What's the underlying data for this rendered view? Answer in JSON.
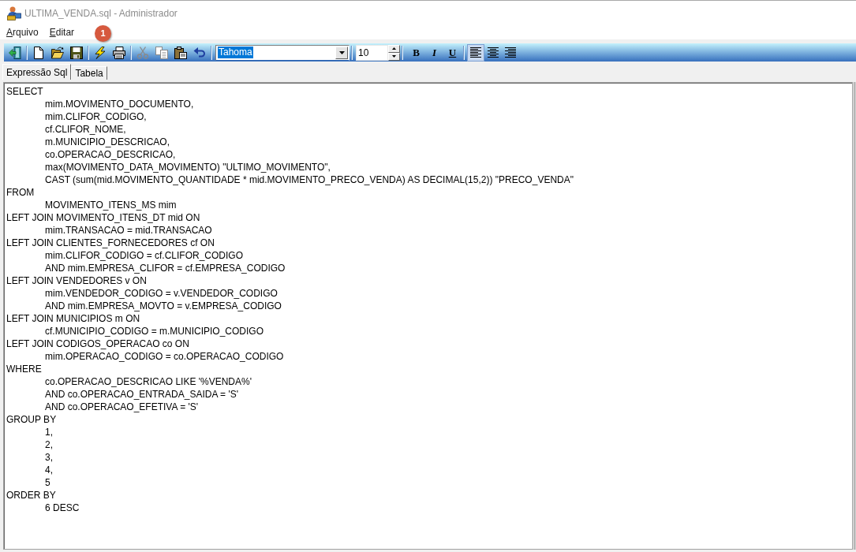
{
  "window": {
    "title": "ULTIMA_VENDA.sql - Administrador"
  },
  "menu": [
    {
      "label": "Arquivo"
    },
    {
      "label": "Editar"
    }
  ],
  "badge": {
    "label": "1"
  },
  "toolbar": {
    "font_field": {
      "value": "Tahoma",
      "highlighted": true
    },
    "size_field": {
      "value": "10"
    },
    "format_buttons": [
      {
        "kind": "bold",
        "label": "B"
      },
      {
        "kind": "italic",
        "label": "I"
      },
      {
        "kind": "underline",
        "label": "U"
      }
    ],
    "alignment_buttons": [
      {
        "kind": "left",
        "selected": true
      },
      {
        "kind": "center",
        "selected": false
      },
      {
        "kind": "right",
        "selected": false
      }
    ]
  },
  "tabs": [
    {
      "label": "Expressão Sql",
      "selected": true
    },
    {
      "label": "Tabela",
      "selected": false
    }
  ],
  "editor": {
    "lines": [
      {
        "text": "SELECT",
        "children": [
          {
            "text": "mim.MOVIMENTO_DOCUMENTO,"
          },
          {
            "text": "mim.CLIFOR_CODIGO,"
          },
          {
            "text": "cf.CLIFOR_NOME,"
          },
          {
            "text": "m.MUNICIPIO_DESCRICAO,"
          },
          {
            "text": "co.OPERACAO_DESCRICAO,"
          },
          {
            "text": "max(MOVIMENTO_DATA_MOVIMENTO) \"ULTIMO_MOVIMENTO\","
          },
          {
            "text": "CAST (sum(mid.MOVIMENTO_QUANTIDADE * mid.MOVIMENTO_PRECO_VENDA) AS DECIMAL(15,2)) \"PRECO_VENDA\""
          }
        ]
      },
      {
        "text": "FROM",
        "children": [
          {
            "text": "MOVIMENTO_ITENS_MS mim"
          }
        ]
      },
      {
        "text": "LEFT JOIN MOVIMENTO_ITENS_DT mid ON",
        "children": [
          {
            "text": "mim.TRANSACAO = mid.TRANSACAO"
          }
        ]
      },
      {
        "text": "LEFT JOIN CLIENTES_FORNECEDORES cf ON",
        "children": [
          {
            "text": "mim.CLIFOR_CODIGO = cf.CLIFOR_CODIGO"
          },
          {
            "text": "AND mim.EMPRESA_CLIFOR = cf.EMPRESA_CODIGO"
          }
        ]
      },
      {
        "text": "LEFT JOIN VENDEDORES v ON",
        "children": [
          {
            "text": "mim.VENDEDOR_CODIGO = v.VENDEDOR_CODIGO"
          },
          {
            "text": "AND mim.EMPRESA_MOVTO = v.EMPRESA_CODIGO"
          }
        ]
      },
      {
        "text": "LEFT JOIN MUNICIPIOS m ON",
        "children": [
          {
            "text": "cf.MUNICIPIO_CODIGO = m.MUNICIPIO_CODIGO"
          }
        ]
      },
      {
        "text": "LEFT JOIN CODIGOS_OPERACAO co ON",
        "children": [
          {
            "text": "mim.OPERACAO_CODIGO = co.OPERACAO_CODIGO"
          }
        ]
      },
      {
        "text": "WHERE",
        "children": [
          {
            "text": "co.OPERACAO_DESCRICAO LIKE '%VENDA%'"
          },
          {
            "text": "AND co.OPERACAO_ENTRADA_SAIDA = 'S'"
          },
          {
            "text": "AND co.OPERACAO_EFETIVA = 'S'"
          }
        ]
      },
      {
        "text": "GROUP BY",
        "children": [
          {
            "text": "1,"
          },
          {
            "text": "2,"
          },
          {
            "text": "3,"
          },
          {
            "text": "4,"
          },
          {
            "text": "5"
          }
        ]
      },
      {
        "text": "ORDER BY",
        "children": [
          {
            "text": "6 DESC"
          }
        ]
      }
    ]
  }
}
